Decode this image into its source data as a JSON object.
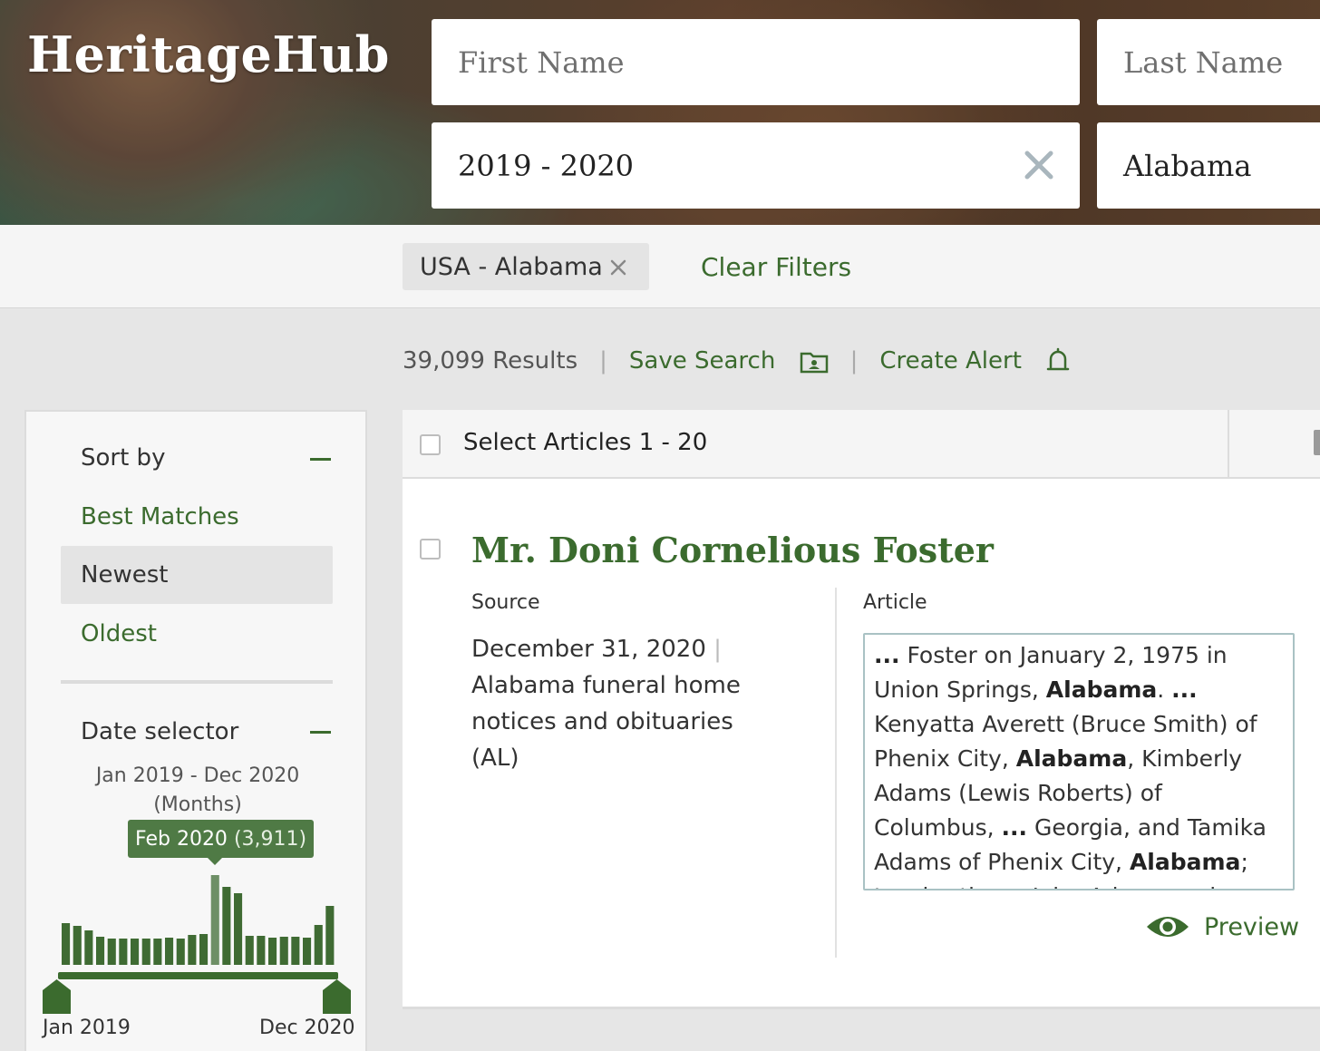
{
  "brand": {
    "logo": "HeritageHub"
  },
  "search": {
    "first_name_placeholder": "First Name",
    "last_name_placeholder": "Last Name",
    "date_range_value": "2019 - 2020",
    "location_value": "Alabama"
  },
  "filters": {
    "chip_label": "USA - Alabama",
    "clear_label": "Clear Filters"
  },
  "results": {
    "count_label": "39,099 Results",
    "save_search_label": "Save Search",
    "create_alert_label": "Create Alert"
  },
  "sidebar": {
    "sort_heading": "Sort by",
    "sort_options": [
      "Best Matches",
      "Newest",
      "Oldest"
    ],
    "active_sort": "Newest",
    "date_heading": "Date selector",
    "date_range_text": "Jan 2019 - Dec 2020",
    "date_unit_text": "(Months)",
    "tooltip_month": "Feb 2020",
    "tooltip_count": "(3,911)",
    "axis_start": "Jan 2019",
    "axis_end": "Dec 2020",
    "histogram_relative": [
      0.46,
      0.43,
      0.38,
      0.31,
      0.29,
      0.29,
      0.29,
      0.29,
      0.29,
      0.3,
      0.29,
      0.33,
      0.34,
      0.99,
      0.86,
      0.79,
      0.32,
      0.32,
      0.3,
      0.31,
      0.31,
      0.3,
      0.44,
      0.65
    ],
    "highlighted_index": 13
  },
  "list": {
    "select_label": "Select Articles 1 - 20"
  },
  "result_item": {
    "title": "Mr. Doni Cornelious Foster",
    "source_heading": "Source",
    "article_heading": "Article",
    "date": "December 31, 2020",
    "publication": "Alabama funeral home notices and obituaries (AL)",
    "snippet_html": "<b>...</b> Foster on January 2, 1975 in Union Springs, <b>Alabama</b>. <b>...</b> Kenyatta Averett (Bruce Smith) of Phenix City, <b>Alabama</b>, Kimberly Adams (Lewis Roberts) of Columbus, <b>...</b> Georgia, and Tamika Adams of Phenix City, <b>Alabama</b>; two brothers, John Adams and Steven Adams; both",
    "preview_label": "Preview"
  },
  "colors": {
    "accent": "#3b6b2e",
    "bar": "#3f6b33",
    "bar_highlight": "#6e8f66"
  },
  "icons": [
    "clear-x-icon",
    "chip-remove-icon",
    "folder-save-icon",
    "bell-icon",
    "minus-icon",
    "eye-icon",
    "slider-handle-icon"
  ]
}
